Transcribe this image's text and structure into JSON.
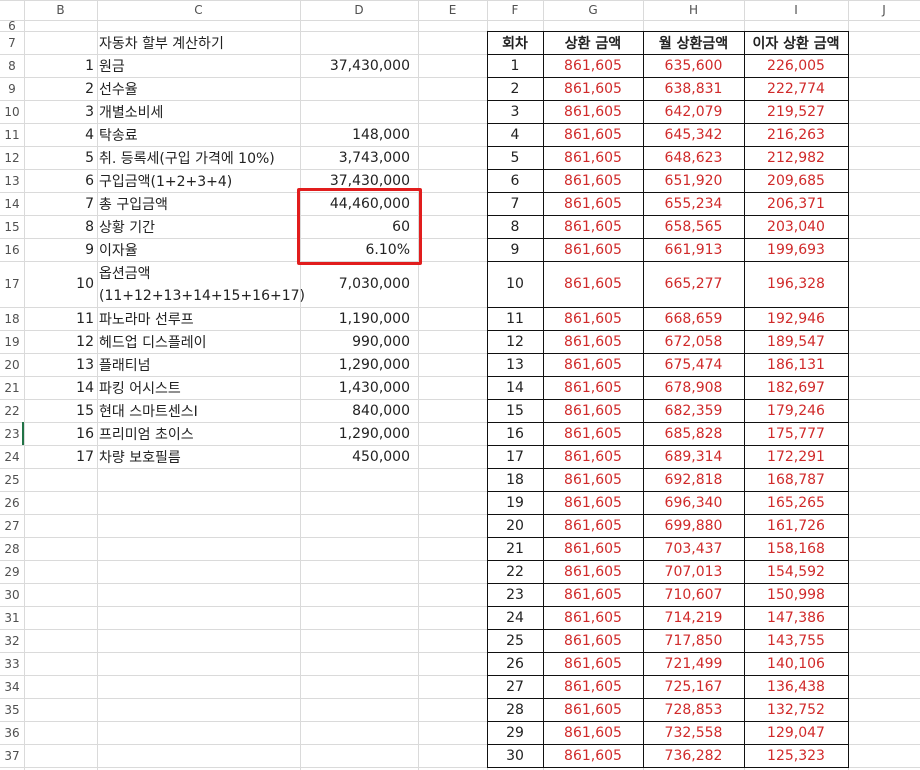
{
  "column_headers": [
    "B",
    "C",
    "D",
    "E",
    "F",
    "G",
    "H",
    "I",
    "J"
  ],
  "row_numbers": [
    "6",
    "7",
    "8",
    "9",
    "10",
    "11",
    "12",
    "13",
    "14",
    "15",
    "16",
    "17",
    "18",
    "19",
    "20",
    "21",
    "22",
    "23",
    "24",
    "25",
    "26",
    "27",
    "28",
    "29",
    "30",
    "31",
    "32",
    "33",
    "34",
    "35",
    "36",
    "37"
  ],
  "calculator": {
    "title": "자동차 할부 계산하기",
    "items": [
      {
        "no": "1",
        "label": "원금",
        "value": "37,430,000"
      },
      {
        "no": "2",
        "label": "선수율",
        "value": ""
      },
      {
        "no": "3",
        "label": "개별소비세",
        "value": ""
      },
      {
        "no": "4",
        "label": "탁송료",
        "value": "148,000"
      },
      {
        "no": "5",
        "label": "취. 등록세(구입 가격에 10%)",
        "value": "3,743,000"
      },
      {
        "no": "6",
        "label": "구입금액(1+2+3+4)",
        "value": "37,430,000"
      },
      {
        "no": "7",
        "label": "총 구입금액",
        "value": "44,460,000"
      },
      {
        "no": "8",
        "label": "상황 기간",
        "value": "60"
      },
      {
        "no": "9",
        "label": "이자율",
        "value": "6.10%"
      },
      {
        "no": "10",
        "label": "옵션금액",
        "label2": "(11+12+13+14+15+16+17)",
        "value": "7,030,000"
      },
      {
        "no": "11",
        "label": "파노라마 선루프",
        "value": "1,190,000"
      },
      {
        "no": "12",
        "label": "헤드업 디스플레이",
        "value": "990,000"
      },
      {
        "no": "13",
        "label": "플래티넘",
        "value": "1,290,000"
      },
      {
        "no": "14",
        "label": "파킹 어시스트",
        "value": "1,430,000"
      },
      {
        "no": "15",
        "label": "현대 스마트센스I",
        "value": "840,000"
      },
      {
        "no": "16",
        "label": "프리미엄 초이스",
        "value": "1,290,000"
      },
      {
        "no": "17",
        "label": "차량 보호필름",
        "value": "450,000"
      }
    ]
  },
  "schedule": {
    "headers": [
      "회차",
      "상환 금액",
      "월 상환금액",
      "이자 상환 금액"
    ],
    "rows": [
      [
        "1",
        "861,605",
        "635,600",
        "226,005"
      ],
      [
        "2",
        "861,605",
        "638,831",
        "222,774"
      ],
      [
        "3",
        "861,605",
        "642,079",
        "219,527"
      ],
      [
        "4",
        "861,605",
        "645,342",
        "216,263"
      ],
      [
        "5",
        "861,605",
        "648,623",
        "212,982"
      ],
      [
        "6",
        "861,605",
        "651,920",
        "209,685"
      ],
      [
        "7",
        "861,605",
        "655,234",
        "206,371"
      ],
      [
        "8",
        "861,605",
        "658,565",
        "203,040"
      ],
      [
        "9",
        "861,605",
        "661,913",
        "199,693"
      ],
      [
        "10",
        "861,605",
        "665,277",
        "196,328"
      ],
      [
        "11",
        "861,605",
        "668,659",
        "192,946"
      ],
      [
        "12",
        "861,605",
        "672,058",
        "189,547"
      ],
      [
        "13",
        "861,605",
        "675,474",
        "186,131"
      ],
      [
        "14",
        "861,605",
        "678,908",
        "182,697"
      ],
      [
        "15",
        "861,605",
        "682,359",
        "179,246"
      ],
      [
        "16",
        "861,605",
        "685,828",
        "175,777"
      ],
      [
        "17",
        "861,605",
        "689,314",
        "172,291"
      ],
      [
        "18",
        "861,605",
        "692,818",
        "168,787"
      ],
      [
        "19",
        "861,605",
        "696,340",
        "165,265"
      ],
      [
        "20",
        "861,605",
        "699,880",
        "161,726"
      ],
      [
        "21",
        "861,605",
        "703,437",
        "158,168"
      ],
      [
        "22",
        "861,605",
        "707,013",
        "154,592"
      ],
      [
        "23",
        "861,605",
        "710,607",
        "150,998"
      ],
      [
        "24",
        "861,605",
        "714,219",
        "147,386"
      ],
      [
        "25",
        "861,605",
        "717,850",
        "143,755"
      ],
      [
        "26",
        "861,605",
        "721,499",
        "140,106"
      ],
      [
        "27",
        "861,605",
        "725,167",
        "136,438"
      ],
      [
        "28",
        "861,605",
        "728,853",
        "132,752"
      ],
      [
        "29",
        "861,605",
        "732,558",
        "129,047"
      ],
      [
        "30",
        "861,605",
        "736,282",
        "125,323"
      ]
    ]
  },
  "colors": {
    "value_red": "#d02a2a",
    "highlight": "#e11d1d",
    "gridline": "#dadada",
    "selected_row": "#217346"
  },
  "selected_row": "23"
}
